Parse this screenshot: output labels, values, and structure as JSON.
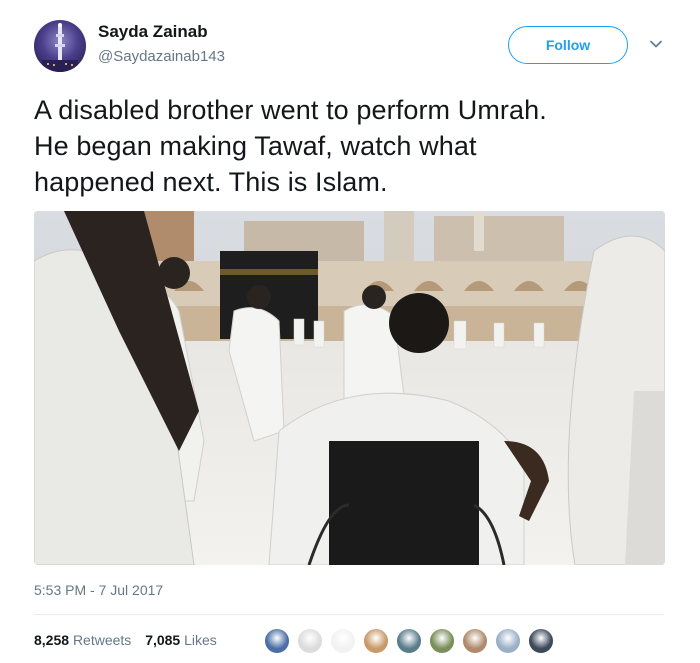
{
  "user": {
    "display_name": "Sayda Zainab",
    "handle": "@Saydazainab143"
  },
  "actions": {
    "follow_label": "Follow"
  },
  "tweet": {
    "text_lines": [
      "A disabled brother went to perform Umrah.",
      "He began making Tawaf, watch what",
      "happened next. This is Islam."
    ],
    "timestamp": "5:53 PM - 7 Jul 2017"
  },
  "stats": {
    "retweets_count": "8,258",
    "retweets_label": "Retweets",
    "likes_count": "7,085",
    "likes_label": "Likes"
  },
  "colors": {
    "accent": "#1da1f2",
    "secondary_text": "#657786",
    "primary_text": "#14171a"
  },
  "likers": [
    {
      "icon": "liker-avatar-1",
      "color": "#4a6fa5"
    },
    {
      "icon": "liker-avatar-2",
      "color": "#dcdcdc"
    },
    {
      "icon": "liker-avatar-3",
      "color": "#f2f2f2"
    },
    {
      "icon": "liker-avatar-4",
      "color": "#c89a6a"
    },
    {
      "icon": "liker-avatar-5",
      "color": "#5a7d8c"
    },
    {
      "icon": "liker-avatar-6",
      "color": "#7a8f5a"
    },
    {
      "icon": "liker-avatar-7",
      "color": "#b08a6c"
    },
    {
      "icon": "liker-avatar-8",
      "color": "#9ab0c8"
    },
    {
      "icon": "liker-avatar-9",
      "color": "#3d4a5a"
    }
  ]
}
